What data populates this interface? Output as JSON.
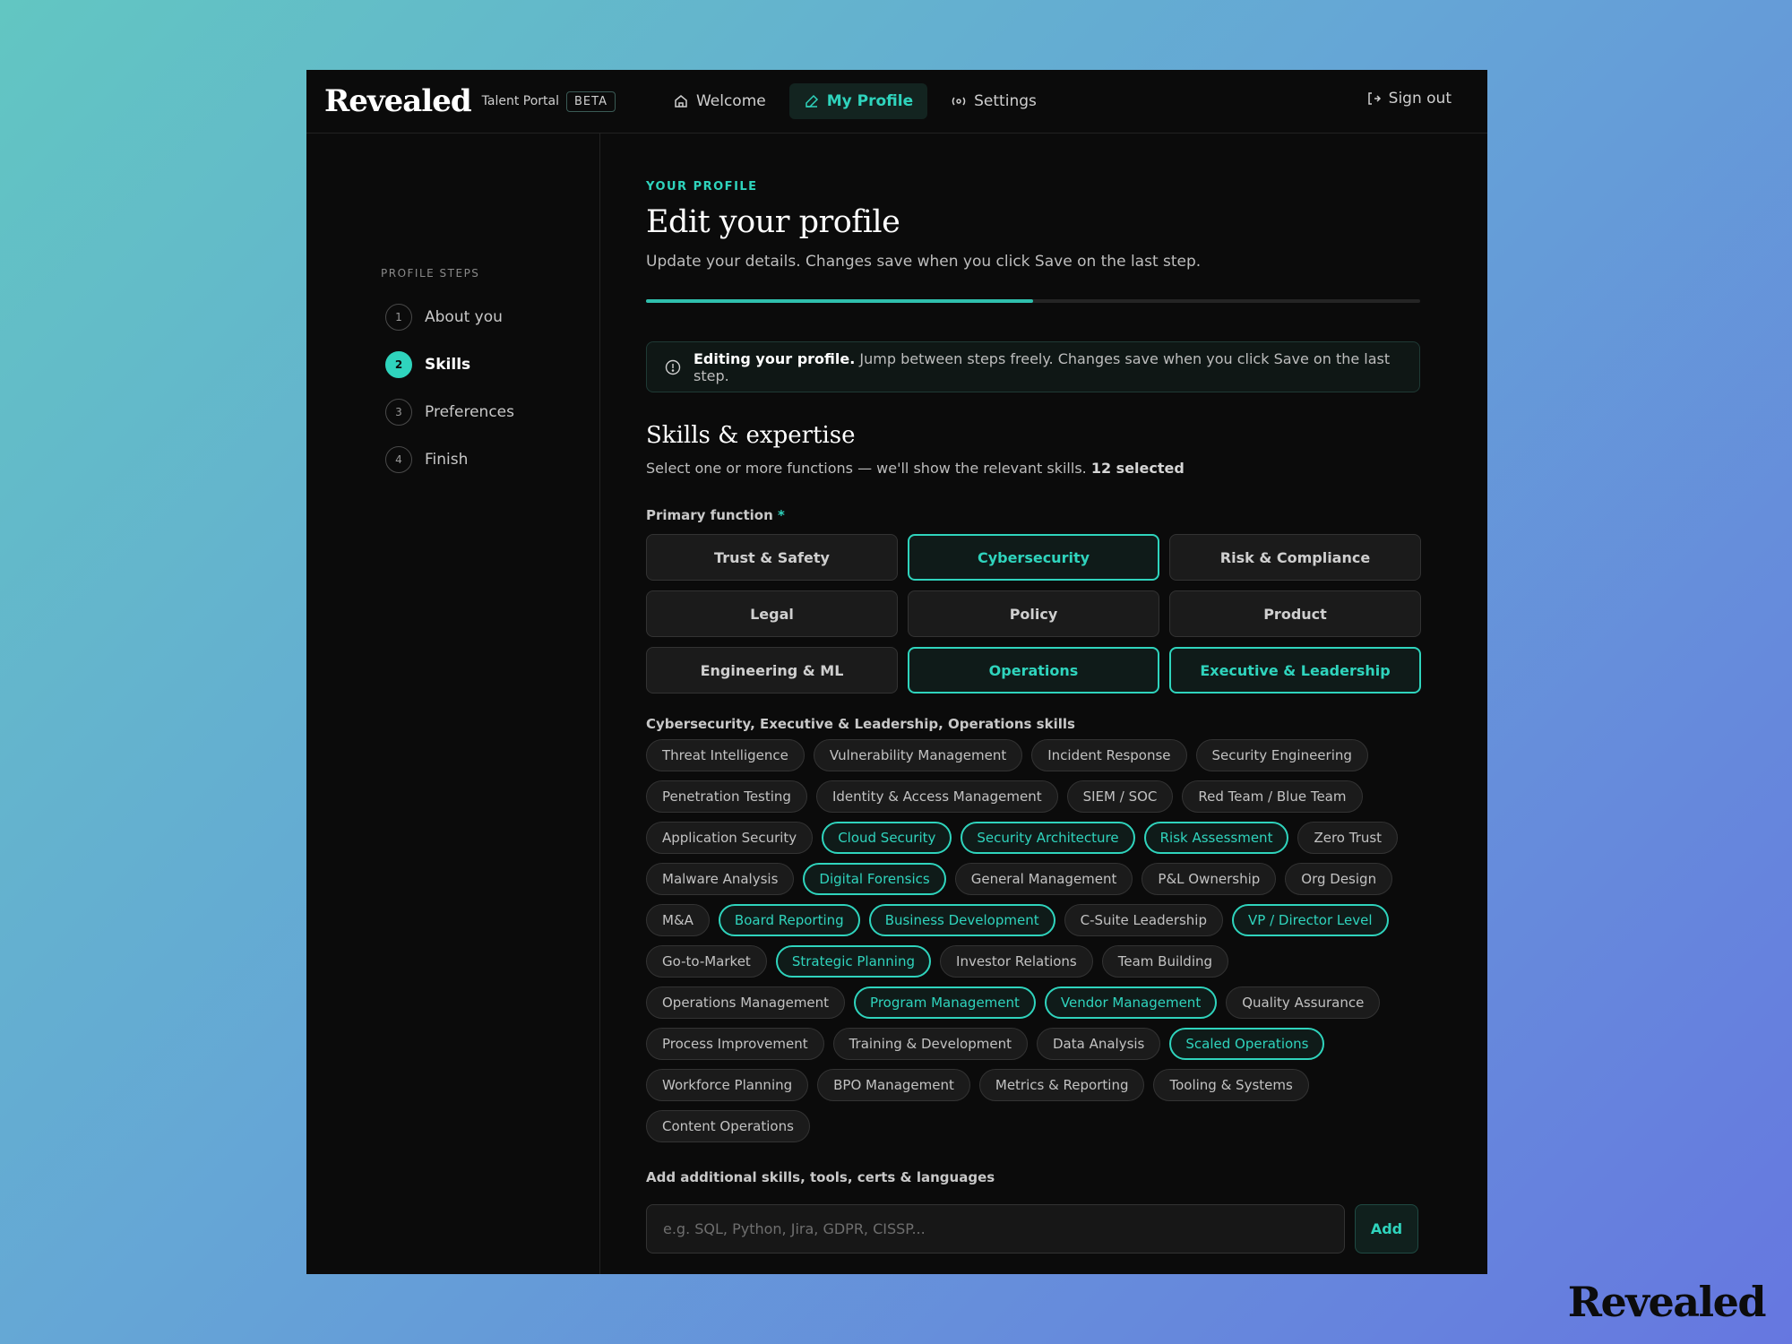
{
  "topbar": {
    "brand": "Revealed",
    "portal": "Talent Portal",
    "beta": "BETA",
    "nav": [
      {
        "label": "Welcome",
        "icon": "home-icon",
        "active": false
      },
      {
        "label": "My Profile",
        "icon": "edit-icon",
        "active": true
      },
      {
        "label": "Settings",
        "icon": "settings-icon",
        "active": false
      }
    ],
    "signout": "Sign out"
  },
  "sidebar": {
    "title": "PROFILE STEPS",
    "steps": [
      {
        "num": "1",
        "label": "About you",
        "active": false
      },
      {
        "num": "2",
        "label": "Skills",
        "active": true
      },
      {
        "num": "3",
        "label": "Preferences",
        "active": false
      },
      {
        "num": "4",
        "label": "Finish",
        "active": false
      }
    ]
  },
  "main": {
    "eyebrow": "YOUR PROFILE",
    "title": "Edit your profile",
    "subtitle": "Update your details. Changes save when you click Save on the last step.",
    "progress": 0.5,
    "notice": {
      "bold": "Editing your profile.",
      "text": " Jump between steps freely. Changes save when you click Save on the last step."
    },
    "section_title": "Skills & expertise",
    "section_sub": "Select one or more functions — we'll show the relevant skills. ",
    "selected_count": "12 selected",
    "primary_label": "Primary function",
    "required_mark": "*",
    "functions": [
      {
        "label": "Trust & Safety",
        "selected": false
      },
      {
        "label": "Cybersecurity",
        "selected": true
      },
      {
        "label": "Risk & Compliance",
        "selected": false
      },
      {
        "label": "Legal",
        "selected": false
      },
      {
        "label": "Policy",
        "selected": false
      },
      {
        "label": "Product",
        "selected": false
      },
      {
        "label": "Engineering & ML",
        "selected": false
      },
      {
        "label": "Operations",
        "selected": true
      },
      {
        "label": "Executive & Leadership",
        "selected": true
      }
    ],
    "skills_label": "Cybersecurity, Executive & Leadership, Operations skills",
    "skills": [
      {
        "label": "Threat Intelligence",
        "selected": false
      },
      {
        "label": "Vulnerability Management",
        "selected": false
      },
      {
        "label": "Incident Response",
        "selected": false
      },
      {
        "label": "Security Engineering",
        "selected": false
      },
      {
        "label": "Penetration Testing",
        "selected": false
      },
      {
        "label": "Identity & Access Management",
        "selected": false
      },
      {
        "label": "SIEM / SOC",
        "selected": false
      },
      {
        "label": "Red Team / Blue Team",
        "selected": false
      },
      {
        "label": "Application Security",
        "selected": false
      },
      {
        "label": "Cloud Security",
        "selected": true
      },
      {
        "label": "Security Architecture",
        "selected": true
      },
      {
        "label": "Risk Assessment",
        "selected": true
      },
      {
        "label": "Zero Trust",
        "selected": false
      },
      {
        "label": "Malware Analysis",
        "selected": false
      },
      {
        "label": "Digital Forensics",
        "selected": true
      },
      {
        "label": "General Management",
        "selected": false
      },
      {
        "label": "P&L Ownership",
        "selected": false
      },
      {
        "label": "Org Design",
        "selected": false
      },
      {
        "label": "M&A",
        "selected": false
      },
      {
        "label": "Board Reporting",
        "selected": true
      },
      {
        "label": "Business Development",
        "selected": true
      },
      {
        "label": "C-Suite Leadership",
        "selected": false
      },
      {
        "label": "VP / Director Level",
        "selected": true
      },
      {
        "label": "Go-to-Market",
        "selected": false
      },
      {
        "label": "Strategic Planning",
        "selected": true
      },
      {
        "label": "Investor Relations",
        "selected": false
      },
      {
        "label": "Team Building",
        "selected": false
      },
      {
        "label": "Operations Management",
        "selected": false
      },
      {
        "label": "Program Management",
        "selected": true
      },
      {
        "label": "Vendor Management",
        "selected": true
      },
      {
        "label": "Quality Assurance",
        "selected": false
      },
      {
        "label": "Process Improvement",
        "selected": false
      },
      {
        "label": "Training & Development",
        "selected": false
      },
      {
        "label": "Data Analysis",
        "selected": false
      },
      {
        "label": "Scaled Operations",
        "selected": true
      },
      {
        "label": "Workforce Planning",
        "selected": false
      },
      {
        "label": "BPO Management",
        "selected": false
      },
      {
        "label": "Metrics & Reporting",
        "selected": false
      },
      {
        "label": "Tooling & Systems",
        "selected": false
      },
      {
        "label": "Content Operations",
        "selected": false
      }
    ],
    "add_label": "Add additional skills, tools, certs & languages",
    "add_placeholder": "e.g. SQL, Python, Jira, GDPR, CISSP...",
    "add_button": "Add"
  },
  "corner_brand": "Revealed",
  "colors": {
    "accent": "#2fd4bd",
    "window_bg": "#0b0b0b",
    "chip_bg": "#1b1b1b"
  }
}
